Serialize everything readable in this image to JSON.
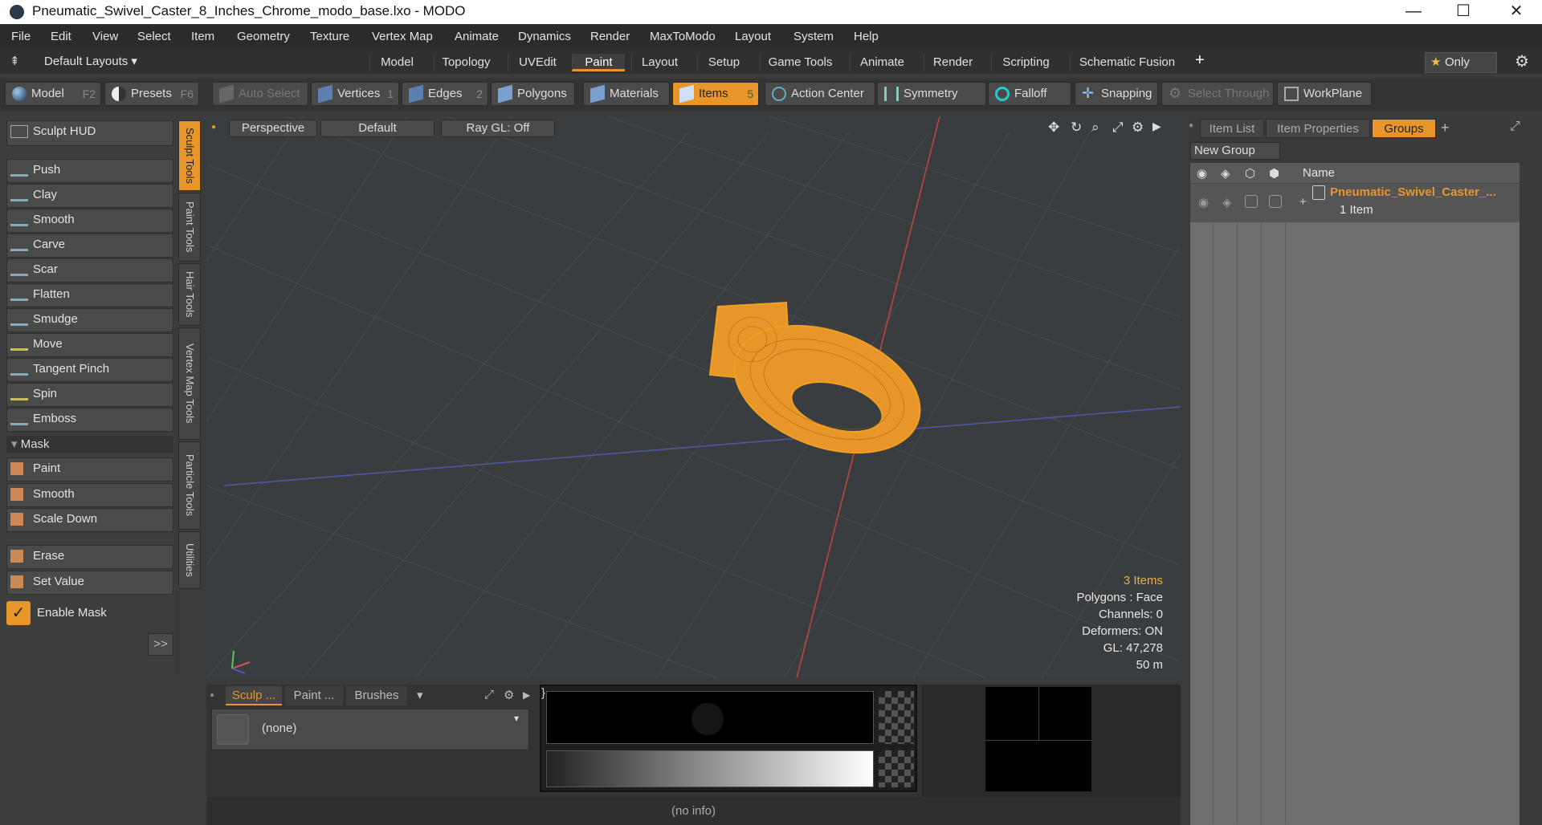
{
  "window": {
    "title": "Pneumatic_Swivel_Caster_8_Inches_Chrome_modo_base.lxo - MODO"
  },
  "menu": [
    "File",
    "Edit",
    "View",
    "Select",
    "Item",
    "Geometry",
    "Texture",
    "Vertex Map",
    "Animate",
    "Dynamics",
    "Render",
    "MaxToModo",
    "Layout",
    "System",
    "Help"
  ],
  "layouts": {
    "label": "Default Layouts ▾",
    "tabs": [
      "Model",
      "Topology",
      "UVEdit",
      "Paint",
      "Layout",
      "Setup",
      "Game Tools",
      "Animate",
      "Render",
      "Scripting",
      "Schematic Fusion"
    ],
    "active": "Paint",
    "only": "Only"
  },
  "toolbar": {
    "model": "Model",
    "model_key": "F2",
    "presets": "Presets",
    "presets_key": "F6",
    "auto_select": "Auto Select",
    "vertices": "Vertices",
    "vertices_n": "1",
    "edges": "Edges",
    "edges_n": "2",
    "polygons": "Polygons",
    "materials": "Materials",
    "items": "Items",
    "items_n": "5",
    "action_center": "Action Center",
    "symmetry": "Symmetry",
    "falloff": "Falloff",
    "snapping": "Snapping",
    "select_through": "Select Through",
    "workplane": "WorkPlane"
  },
  "left": {
    "hud": "Sculpt HUD",
    "tools": [
      "Push",
      "Clay",
      "Smooth",
      "Carve",
      "Scar",
      "Flatten",
      "Smudge",
      "Move",
      "Tangent Pinch",
      "Spin",
      "Emboss"
    ],
    "mask_header": "Mask",
    "mask_tools": [
      "Paint",
      "Smooth",
      "Scale Down"
    ],
    "erase": "Erase",
    "set_value": "Set Value",
    "enable_mask": "Enable Mask",
    "more": ">>"
  },
  "vtabs": [
    "Sculpt Tools",
    "Paint Tools",
    "Hair Tools",
    "Vertex Map Tools",
    "Particle Tools",
    "Utilities"
  ],
  "viewport": {
    "view": "Perspective",
    "style": "Default",
    "raygl": "Ray GL: Off",
    "info": {
      "items": "3 Items",
      "polygons": "Polygons : Face",
      "channels": "Channels: 0",
      "deformers": "Deformers: ON",
      "gl": "GL: 47,278",
      "scale": "50 m"
    }
  },
  "right": {
    "tabs": [
      "Item List",
      "Item Properties",
      "Groups"
    ],
    "active": "Groups",
    "new_group": "New Group",
    "col_name": "Name",
    "group_name": "Pneumatic_Swivel_Caster_...",
    "group_count": "1 Item"
  },
  "bottom": {
    "tabs": [
      "Sculp ...",
      "Paint ...",
      "Brushes"
    ],
    "preset": "(none)"
  },
  "status": "(no info)",
  "colors": {
    "accent": "#e8962a",
    "wire": "#f0a020"
  }
}
